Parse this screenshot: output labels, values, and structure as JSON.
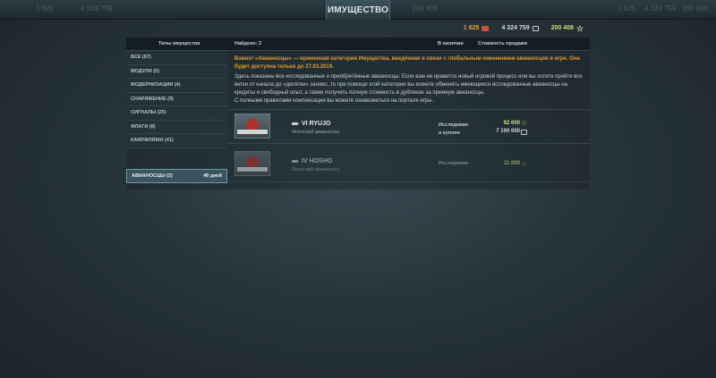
{
  "header": {
    "title": "ИМУЩЕСТВО",
    "ghost_left": [
      "1 625",
      "4 324 759",
      "200 408"
    ],
    "ghost_right": [
      "1 625",
      "4 324 759",
      "200 408"
    ]
  },
  "currencies": {
    "doubloons": "1 625",
    "credits": "4 324 759",
    "free_xp": "200 408"
  },
  "columns": {
    "types": "Типы имущества",
    "found": "Найдено: 2",
    "in_stock": "В наличии",
    "sale_value": "Стоимость продажи"
  },
  "categories": [
    {
      "label": "ВСЕ (87)"
    },
    {
      "label": "МОДУЛИ (0)"
    },
    {
      "label": "МОДЕРНИЗАЦИИ (4)"
    },
    {
      "label": "СНАРЯЖЕНИЕ (9)"
    },
    {
      "label": "СИГНАЛЫ (25)"
    },
    {
      "label": "ФЛАГИ (8)"
    },
    {
      "label": "КАМУФЛЯЖИ (41)"
    }
  ],
  "active_category": {
    "label": "АВИАНОСЦЫ (2)",
    "days": "48 дней"
  },
  "notice": {
    "warning": "Важно! «Авианосцы» — временная категория Имущества, введённая в связи с глобальным изменением авианосцев в игре. Она будет доступна только до 27.03.2019.",
    "body": "Здесь показаны все исследованные и приобретённые авианосцы. Если вам не нравится новый игровой процесс или вы хотите пройти все ветки от начала до «десятки» заново, то при помощи этой категории вы можете обменять имеющиеся исследованные авианосцы на кредиты и свободный опыт, а также получить полную стоимость в дублонах за премиум авианосцы.",
    "body2": "С полными правилами компенсации вы можете ознакомиться на портале игры."
  },
  "ships": [
    {
      "name": "VI RYUJO",
      "subtitle": "Японский авианосец",
      "status_line1": "Исследован",
      "status_line2": "и куплен",
      "price_xp": "92 000",
      "price_credits": "7 100 000"
    },
    {
      "name": "IV HOSHO",
      "subtitle": "Японский авианосец",
      "status_line1": "Исследован",
      "price_xp": "11 000"
    }
  ]
}
